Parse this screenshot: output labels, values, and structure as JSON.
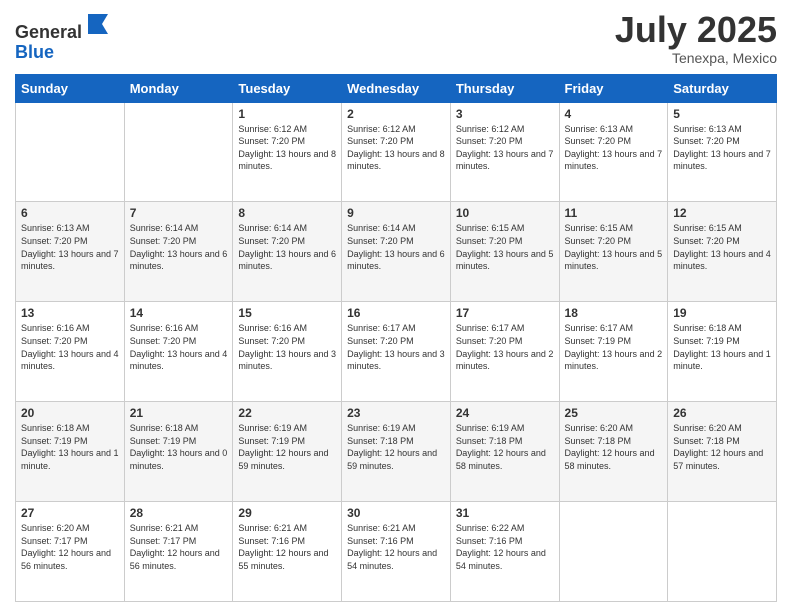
{
  "logo": {
    "line1": "General",
    "line2": "Blue"
  },
  "title": {
    "month_year": "July 2025",
    "location": "Tenexpa, Mexico"
  },
  "weekdays": [
    "Sunday",
    "Monday",
    "Tuesday",
    "Wednesday",
    "Thursday",
    "Friday",
    "Saturday"
  ],
  "weeks": [
    [
      {
        "day": "",
        "info": ""
      },
      {
        "day": "",
        "info": ""
      },
      {
        "day": "1",
        "info": "Sunrise: 6:12 AM\nSunset: 7:20 PM\nDaylight: 13 hours and 8 minutes."
      },
      {
        "day": "2",
        "info": "Sunrise: 6:12 AM\nSunset: 7:20 PM\nDaylight: 13 hours and 8 minutes."
      },
      {
        "day": "3",
        "info": "Sunrise: 6:12 AM\nSunset: 7:20 PM\nDaylight: 13 hours and 7 minutes."
      },
      {
        "day": "4",
        "info": "Sunrise: 6:13 AM\nSunset: 7:20 PM\nDaylight: 13 hours and 7 minutes."
      },
      {
        "day": "5",
        "info": "Sunrise: 6:13 AM\nSunset: 7:20 PM\nDaylight: 13 hours and 7 minutes."
      }
    ],
    [
      {
        "day": "6",
        "info": "Sunrise: 6:13 AM\nSunset: 7:20 PM\nDaylight: 13 hours and 7 minutes."
      },
      {
        "day": "7",
        "info": "Sunrise: 6:14 AM\nSunset: 7:20 PM\nDaylight: 13 hours and 6 minutes."
      },
      {
        "day": "8",
        "info": "Sunrise: 6:14 AM\nSunset: 7:20 PM\nDaylight: 13 hours and 6 minutes."
      },
      {
        "day": "9",
        "info": "Sunrise: 6:14 AM\nSunset: 7:20 PM\nDaylight: 13 hours and 6 minutes."
      },
      {
        "day": "10",
        "info": "Sunrise: 6:15 AM\nSunset: 7:20 PM\nDaylight: 13 hours and 5 minutes."
      },
      {
        "day": "11",
        "info": "Sunrise: 6:15 AM\nSunset: 7:20 PM\nDaylight: 13 hours and 5 minutes."
      },
      {
        "day": "12",
        "info": "Sunrise: 6:15 AM\nSunset: 7:20 PM\nDaylight: 13 hours and 4 minutes."
      }
    ],
    [
      {
        "day": "13",
        "info": "Sunrise: 6:16 AM\nSunset: 7:20 PM\nDaylight: 13 hours and 4 minutes."
      },
      {
        "day": "14",
        "info": "Sunrise: 6:16 AM\nSunset: 7:20 PM\nDaylight: 13 hours and 4 minutes."
      },
      {
        "day": "15",
        "info": "Sunrise: 6:16 AM\nSunset: 7:20 PM\nDaylight: 13 hours and 3 minutes."
      },
      {
        "day": "16",
        "info": "Sunrise: 6:17 AM\nSunset: 7:20 PM\nDaylight: 13 hours and 3 minutes."
      },
      {
        "day": "17",
        "info": "Sunrise: 6:17 AM\nSunset: 7:20 PM\nDaylight: 13 hours and 2 minutes."
      },
      {
        "day": "18",
        "info": "Sunrise: 6:17 AM\nSunset: 7:19 PM\nDaylight: 13 hours and 2 minutes."
      },
      {
        "day": "19",
        "info": "Sunrise: 6:18 AM\nSunset: 7:19 PM\nDaylight: 13 hours and 1 minute."
      }
    ],
    [
      {
        "day": "20",
        "info": "Sunrise: 6:18 AM\nSunset: 7:19 PM\nDaylight: 13 hours and 1 minute."
      },
      {
        "day": "21",
        "info": "Sunrise: 6:18 AM\nSunset: 7:19 PM\nDaylight: 13 hours and 0 minutes."
      },
      {
        "day": "22",
        "info": "Sunrise: 6:19 AM\nSunset: 7:19 PM\nDaylight: 12 hours and 59 minutes."
      },
      {
        "day": "23",
        "info": "Sunrise: 6:19 AM\nSunset: 7:18 PM\nDaylight: 12 hours and 59 minutes."
      },
      {
        "day": "24",
        "info": "Sunrise: 6:19 AM\nSunset: 7:18 PM\nDaylight: 12 hours and 58 minutes."
      },
      {
        "day": "25",
        "info": "Sunrise: 6:20 AM\nSunset: 7:18 PM\nDaylight: 12 hours and 58 minutes."
      },
      {
        "day": "26",
        "info": "Sunrise: 6:20 AM\nSunset: 7:18 PM\nDaylight: 12 hours and 57 minutes."
      }
    ],
    [
      {
        "day": "27",
        "info": "Sunrise: 6:20 AM\nSunset: 7:17 PM\nDaylight: 12 hours and 56 minutes."
      },
      {
        "day": "28",
        "info": "Sunrise: 6:21 AM\nSunset: 7:17 PM\nDaylight: 12 hours and 56 minutes."
      },
      {
        "day": "29",
        "info": "Sunrise: 6:21 AM\nSunset: 7:16 PM\nDaylight: 12 hours and 55 minutes."
      },
      {
        "day": "30",
        "info": "Sunrise: 6:21 AM\nSunset: 7:16 PM\nDaylight: 12 hours and 54 minutes."
      },
      {
        "day": "31",
        "info": "Sunrise: 6:22 AM\nSunset: 7:16 PM\nDaylight: 12 hours and 54 minutes."
      },
      {
        "day": "",
        "info": ""
      },
      {
        "day": "",
        "info": ""
      }
    ]
  ]
}
